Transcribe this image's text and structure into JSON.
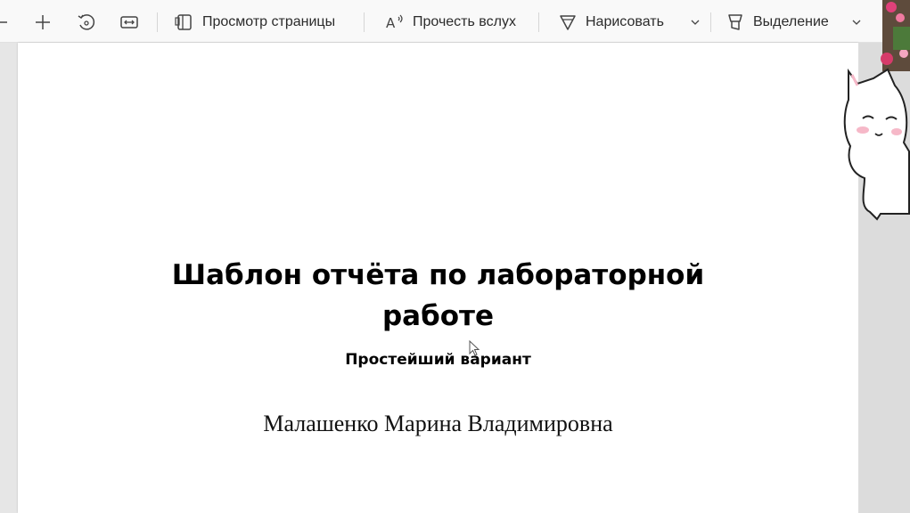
{
  "toolbar": {
    "page_view_label": "Просмотр страницы",
    "read_aloud_label": "Прочесть вслух",
    "draw_label": "Нарисовать",
    "highlight_label": "Выделение"
  },
  "document": {
    "title_line1": "Шаблон отчёта по лабораторной",
    "title_line2": "работе",
    "subtitle": "Простейший вариант",
    "author": "Малашенко Марина Владимировна"
  },
  "colors": {
    "toolbar_bg": "#f9f9f9",
    "page_bg": "#ffffff",
    "viewer_bg": "#e6e6e6",
    "text": "#000000"
  }
}
